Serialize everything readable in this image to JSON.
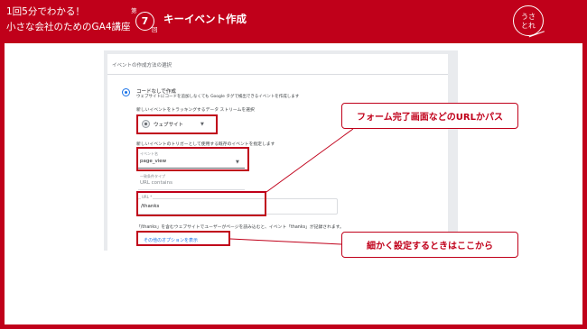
{
  "header": {
    "series_line1": "1回5分でわかる！",
    "series_line2": "小さな会社のためのGA4講座",
    "episode_prefix": "第",
    "episode_number": "7",
    "episode_suffix": "回",
    "episode_title": "キーイベント作成",
    "logo_text": "うさ\nとれ"
  },
  "ga": {
    "section_title": "イベントの作成方法の選択",
    "option_label": "コードなしで作成",
    "option_desc": "ウェブサイトにコードを追加しなくても Google タグで検出できるイベントを作成します",
    "stream_prompt": "新しいイベントをトラッキングするデータ ストリームを選択",
    "stream_value": "ウェブサイト",
    "trigger_prompt": "新しいイベントのトリガーとして使用する既存のイベントを指定します",
    "event_name_label": "イベント名",
    "event_name_value": "page_view",
    "condition_label": "一致条件タイプ",
    "condition_value": "URL contains",
    "url_label": "URL *",
    "url_value": "/thanks",
    "explanation": "「/thanks」を含むウェブサイトでユーザーがページを読み込むと、イベント「thanks」が記録されます。",
    "more_options_link": "その他のオプションを表示"
  },
  "callouts": {
    "url_callout": "フォーム完了画面などのURLかパス",
    "detail_callout": "細かく設定するときはここから"
  },
  "colors": {
    "brand_red": "#c0001a",
    "link_blue": "#1a73e8"
  }
}
